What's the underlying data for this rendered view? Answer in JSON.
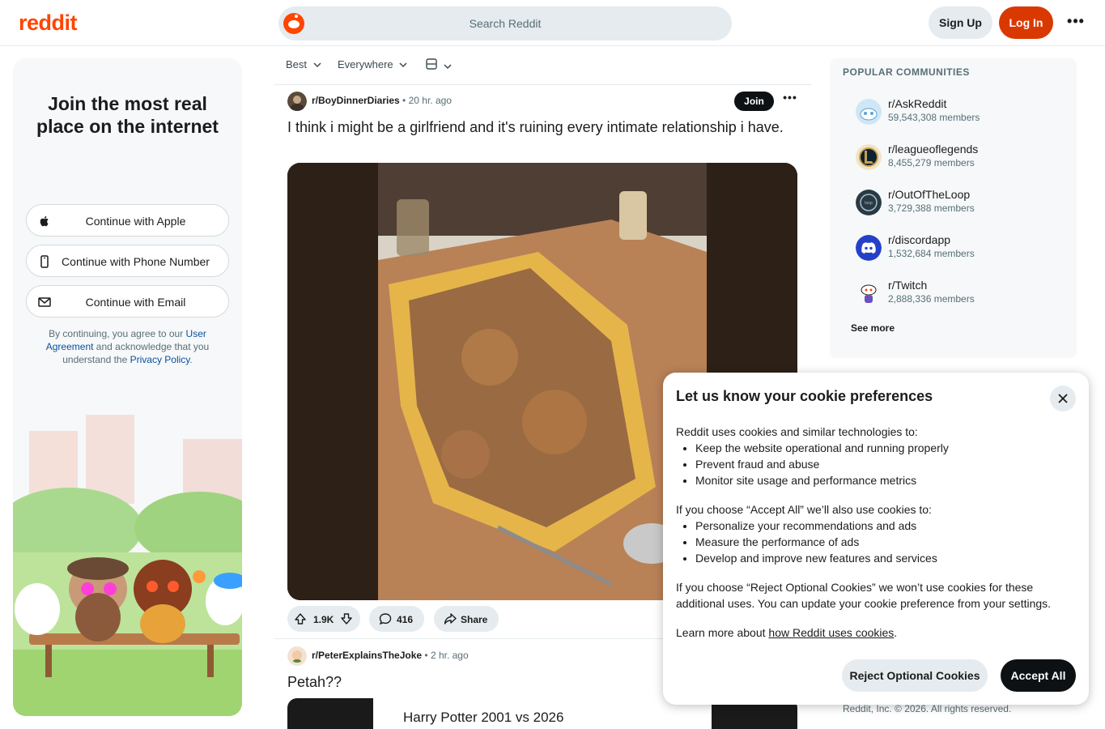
{
  "header": {
    "logo": "reddit",
    "search_placeholder": "Search Reddit",
    "signup_label": "Sign Up",
    "login_label": "Log In"
  },
  "colors": {
    "brand": "#ff4500",
    "login_button": "#d93900",
    "link": "#0a50a0"
  },
  "left_card": {
    "title": "Join the most real place on the internet",
    "buttons": [
      {
        "label": "Continue with Apple",
        "icon": "apple-icon"
      },
      {
        "label": "Continue with Phone Number",
        "icon": "phone-icon"
      },
      {
        "label": "Continue with Email",
        "icon": "mail-icon"
      }
    ],
    "terms_prefix": "By continuing, you agree to our",
    "terms_link1": "User Agreement",
    "terms_middle": "and acknowledge that you understand the",
    "terms_link2": "Privacy Policy",
    "terms_suffix": "."
  },
  "feed": {
    "sort_label": "Best",
    "location_label": "Everywhere",
    "view_icon": "layout-icon",
    "posts": [
      {
        "subreddit": "r/BoyDinnerDiaries",
        "time": "20 hr. ago",
        "join_label": "Join",
        "title": "I think i might be a girlfriend and it's ruining every intimate relationship i have.",
        "votes": "1.9K",
        "comments": "416",
        "share_label": "Share"
      },
      {
        "subreddit": "r/PeterExplainsTheJoke",
        "time": "2 hr. ago",
        "title": "Petah??",
        "image_caption": "Harry Potter 2001 vs 2026"
      }
    ]
  },
  "sidebar": {
    "title": "POPULAR COMMUNITIES",
    "communities": [
      {
        "name": "r/AskReddit",
        "members": "59,543,308 members"
      },
      {
        "name": "r/leagueoflegends",
        "members": "8,455,279 members"
      },
      {
        "name": "r/OutOfTheLoop",
        "members": "3,729,388 members"
      },
      {
        "name": "r/discordapp",
        "members": "1,532,684 members"
      },
      {
        "name": "r/Twitch",
        "members": "2,888,336 members"
      }
    ],
    "see_more": "See more"
  },
  "footer": {
    "copyright": "Reddit, Inc. © 2026. All rights reserved."
  },
  "cookie": {
    "title": "Let us know your cookie preferences",
    "intro": "Reddit uses cookies and similar technologies to:",
    "list1": [
      "Keep the website operational and running properly",
      "Prevent fraud and abuse",
      "Monitor site usage and performance metrics"
    ],
    "accept_intro": "If you choose “Accept All” we’ll also use cookies to:",
    "list2": [
      "Personalize your recommendations and ads",
      "Measure the performance of ads",
      "Develop and improve new features and services"
    ],
    "reject_text": "If you choose “Reject Optional Cookies” we won’t use cookies for these additional uses. You can update your cookie preference from your settings.",
    "learn_prefix": "Learn more about",
    "learn_link": "how Reddit uses cookies",
    "learn_suffix": ".",
    "reject_label": "Reject Optional Cookies",
    "accept_label": "Accept All"
  }
}
